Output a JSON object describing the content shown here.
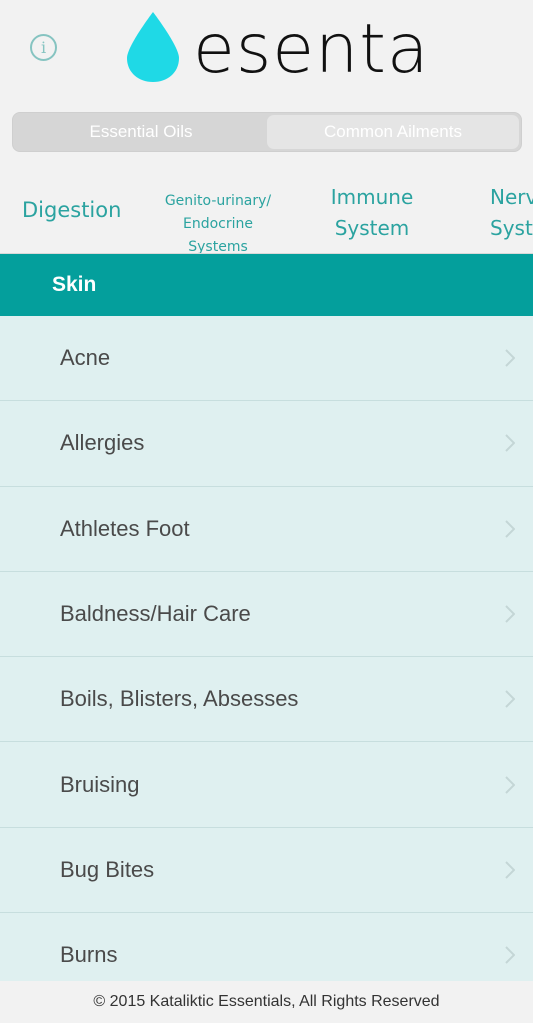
{
  "header": {
    "app_name": "esenta",
    "info_icon": "info-icon",
    "logo_icon": "drop-icon",
    "brand_color": "#1fd9e6"
  },
  "segmented": {
    "options": [
      "Essential Oils",
      "Common Ailments"
    ],
    "selected": "Common Ailments"
  },
  "tabs": [
    {
      "lines": [
        "Digestion"
      ]
    },
    {
      "lines": [
        "Genito-urinary/",
        "Endocrine Systems"
      ]
    },
    {
      "lines": [
        "Immune",
        "System"
      ]
    },
    {
      "lines": [
        "Nerve",
        "Syste"
      ]
    }
  ],
  "accent_color": "#049f9c",
  "section": {
    "title": "Skin"
  },
  "items": [
    "Acne",
    "Allergies",
    "Athletes Foot",
    "Baldness/Hair Care",
    "Boils, Blisters, Absesses",
    "Bruising",
    "Bug Bites",
    "Burns"
  ],
  "footer": {
    "text": "© 2015 Kataliktic Essentials, All Rights Reserved"
  }
}
